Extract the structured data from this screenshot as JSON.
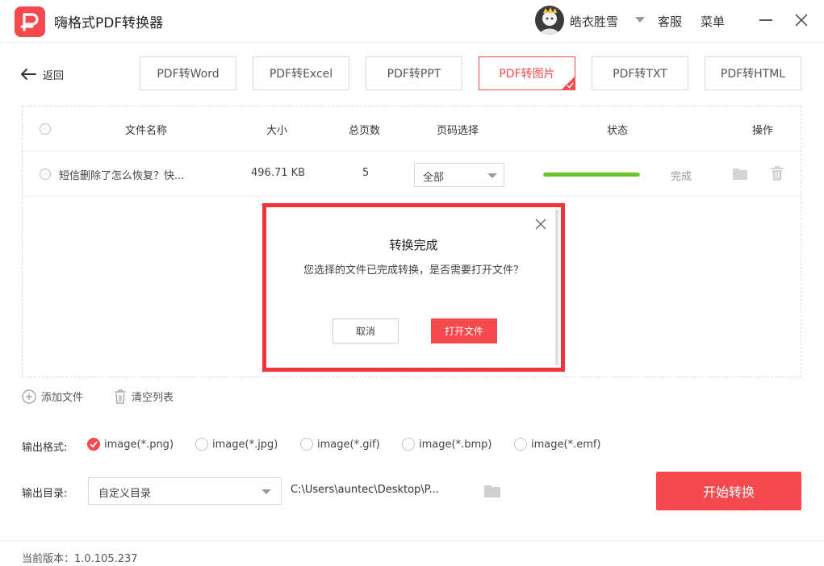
{
  "app": {
    "title": "嗨格式PDF转换器",
    "brand_color": "#f44a4e"
  },
  "header": {
    "username": "皓衣胜雪",
    "service_label": "客服",
    "menu_label": "菜单"
  },
  "nav": {
    "back_label": "返回",
    "tabs": [
      {
        "label": "PDF转Word",
        "active": false
      },
      {
        "label": "PDF转Excel",
        "active": false
      },
      {
        "label": "PDF转PPT",
        "active": false
      },
      {
        "label": "PDF转图片",
        "active": true
      },
      {
        "label": "PDF转TXT",
        "active": false
      },
      {
        "label": "PDF转HTML",
        "active": false
      }
    ]
  },
  "table": {
    "headers": {
      "name": "文件名称",
      "size": "大小",
      "pages": "总页数",
      "page_select": "页码选择",
      "status": "状态",
      "actions": "操作"
    },
    "rows": [
      {
        "name": "短信删除了怎么恢复？快...",
        "size": "496.71 KB",
        "pages": "5",
        "page_select": "全部",
        "progress": 1.0,
        "status": "完成",
        "progress_color": "#68c62b"
      }
    ]
  },
  "dialog": {
    "title": "转换完成",
    "message": "您选择的文件已完成转换，是否需要打开文件？",
    "cancel_label": "取消",
    "open_label": "打开文件"
  },
  "file_actions": {
    "add_label": "添加文件",
    "clear_label": "清空列表"
  },
  "output": {
    "format_label": "输出格式:",
    "formats": [
      {
        "label": "image(*.png)",
        "checked": true
      },
      {
        "label": "image(*.jpg)",
        "checked": false
      },
      {
        "label": "image(*.gif)",
        "checked": false
      },
      {
        "label": "image(*.bmp)",
        "checked": false
      },
      {
        "label": "image(*.emf)",
        "checked": false
      }
    ],
    "dir_label": "输出目录:",
    "dir_select": "自定义目录",
    "dir_path": "C:\\Users\\auntec\\Desktop\\P...",
    "start_label": "开始转换"
  },
  "footer": {
    "version": "当前版本：1.0.105.237"
  }
}
